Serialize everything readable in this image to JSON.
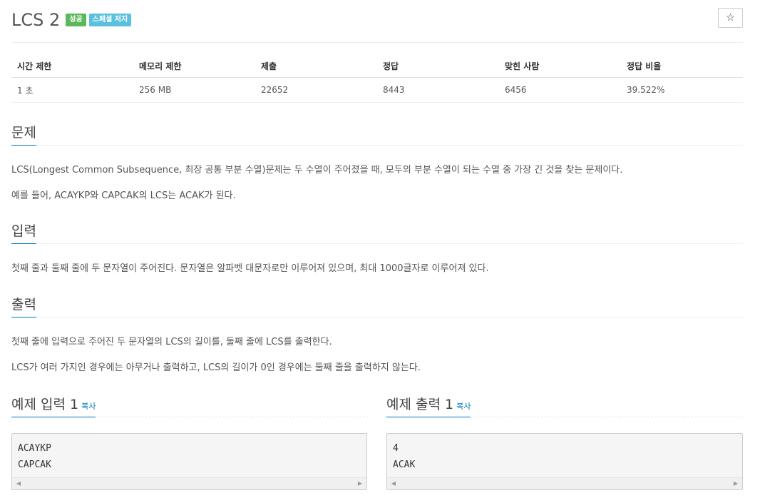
{
  "problem": {
    "title": "LCS 2",
    "badges": {
      "success": "성공",
      "special": "스페셜 저지"
    },
    "star_icon": "☆"
  },
  "info": {
    "headers": [
      "시간 제한",
      "메모리 제한",
      "제출",
      "정답",
      "맞힌 사람",
      "정답 비율"
    ],
    "values": [
      "1 초",
      "256 MB",
      "22652",
      "8443",
      "6456",
      "39.522%"
    ]
  },
  "description": {
    "heading": "문제",
    "paragraphs": [
      "LCS(Longest Common Subsequence, 최장 공통 부분 수열)문제는 두 수열이 주어졌을 때, 모두의 부분 수열이 되는 수열 중 가장 긴 것을 찾는 문제이다.",
      "예를 들어, ACAYKP와 CAPCAK의 LCS는 ACAK가 된다."
    ]
  },
  "input": {
    "heading": "입력",
    "paragraphs": [
      "첫째 줄과 둘째 줄에 두 문자열이 주어진다. 문자열은 알파벳 대문자로만 이루어져 있으며, 최대 1000글자로 이루어져 있다."
    ]
  },
  "output": {
    "heading": "출력",
    "paragraphs": [
      "첫째 줄에 입력으로 주어진 두 문자열의 LCS의 길이를, 둘째 줄에 LCS를 출력한다.",
      "LCS가 여러 가지인 경우에는 아무거나 출력하고, LCS의 길이가 0인 경우에는 둘째 줄을 출력하지 않는다."
    ]
  },
  "samples": {
    "input": {
      "heading": "예제 입력 1",
      "copy_label": "복사",
      "lines": [
        "ACAYKP",
        "CAPCAK"
      ]
    },
    "output": {
      "heading": "예제 출력 1",
      "copy_label": "복사",
      "lines": [
        "4",
        "ACAK"
      ]
    }
  },
  "colors": {
    "accent": "#0076c0",
    "success": "#5cb85c",
    "special": "#5bc0de"
  }
}
